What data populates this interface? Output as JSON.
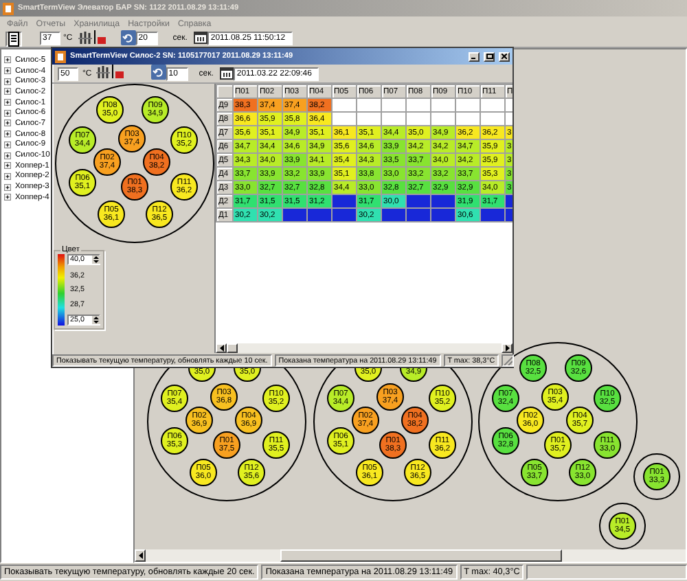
{
  "window": {
    "title": "SmartTermView Элеватор БАР SN: 1122 2011.08.29 13:11:49",
    "active": false
  },
  "menu": [
    "Файл",
    "Отчеты",
    "Хранилища",
    "Настройки",
    "Справка"
  ],
  "toolbar": {
    "temperature": "37",
    "temperature_unit": "°C",
    "interval": "20",
    "interval_unit": "сек.",
    "datetime": "2011.08.25 11:50:12"
  },
  "tree": [
    {
      "label": "Силос-5",
      "expanded": false
    },
    {
      "label": "Силос-4",
      "expanded": false
    },
    {
      "label": "Силос-3",
      "expanded": false
    },
    {
      "label": "Силос-2",
      "expanded": false
    },
    {
      "label": "Силос-1",
      "expanded": false
    },
    {
      "label": "Силос-6",
      "expanded": false
    },
    {
      "label": "Силос-7",
      "expanded": false
    },
    {
      "label": "Силос-8",
      "expanded": false
    },
    {
      "label": "Силос-9",
      "expanded": false
    },
    {
      "label": "Силос-10",
      "expanded": false
    },
    {
      "label": "Хоппер-1",
      "expanded": false
    },
    {
      "label": "Хоппер-2",
      "expanded": false
    },
    {
      "label": "Хоппер-3",
      "expanded": false
    },
    {
      "label": "Хоппер-4",
      "expanded": false
    }
  ],
  "silos": [
    {
      "kind": "silo",
      "sensors": [
        {
          "value": "35,0",
          "color": "#e0f020"
        },
        {
          "value": "35,0",
          "color": "#e0f020"
        },
        {
          "label": "П07",
          "value": "35,4",
          "color": "#e0f020"
        },
        {
          "label": "П03",
          "value": "36,8",
          "color": "#f8c020"
        },
        {
          "label": "П10",
          "value": "35,2",
          "color": "#e0f020"
        },
        {
          "label": "П02",
          "value": "36,9",
          "color": "#f8c020"
        },
        {
          "label": "П04",
          "value": "36,9",
          "color": "#f8c020"
        },
        {
          "label": "П06",
          "value": "35,3",
          "color": "#e0f020"
        },
        {
          "label": "П01",
          "value": "37,5",
          "color": "#f8a020"
        },
        {
          "label": "П11",
          "value": "35,5",
          "color": "#e0f020"
        },
        {
          "label": "П05",
          "value": "36,0",
          "color": "#f8e820"
        },
        {
          "label": "П12",
          "value": "35,6",
          "color": "#e0f020"
        }
      ]
    },
    {
      "kind": "silo",
      "sensors": [
        {
          "value": "35,0",
          "color": "#e0f020"
        },
        {
          "value": "34,9",
          "color": "#b8ec28"
        },
        {
          "label": "П07",
          "value": "34,4",
          "color": "#b8ec28"
        },
        {
          "label": "П03",
          "value": "37,4",
          "color": "#f8a020"
        },
        {
          "label": "П10",
          "value": "35,2",
          "color": "#e0f020"
        },
        {
          "label": "П02",
          "value": "37,4",
          "color": "#f8a020"
        },
        {
          "label": "П04",
          "value": "38,2",
          "color": "#f07020"
        },
        {
          "label": "П06",
          "value": "35,1",
          "color": "#e0f020"
        },
        {
          "label": "П01",
          "value": "38,3",
          "color": "#f07020"
        },
        {
          "label": "П11",
          "value": "36,2",
          "color": "#f8e820"
        },
        {
          "label": "П05",
          "value": "36,1",
          "color": "#f8e820"
        },
        {
          "label": "П12",
          "value": "36,5",
          "color": "#f8e820"
        }
      ]
    },
    {
      "kind": "silo",
      "sensors": [
        {
          "label": "П08",
          "value": "32,5",
          "color": "#58e040"
        },
        {
          "label": "П09",
          "value": "32,6",
          "color": "#58e040"
        },
        {
          "label": "П07",
          "value": "32,4",
          "color": "#58e040"
        },
        {
          "label": "П03",
          "value": "35,4",
          "color": "#e0f020"
        },
        {
          "label": "П10",
          "value": "32,5",
          "color": "#58e040"
        },
        {
          "label": "П02",
          "value": "36,0",
          "color": "#f8e820"
        },
        {
          "label": "П04",
          "value": "35,7",
          "color": "#e0f020"
        },
        {
          "label": "П06",
          "value": "32,8",
          "color": "#58e040"
        },
        {
          "label": "П01",
          "value": "35,7",
          "color": "#e0f020"
        },
        {
          "label": "П11",
          "value": "33,0",
          "color": "#88e430"
        },
        {
          "label": "П05",
          "value": "33,7",
          "color": "#88e430"
        },
        {
          "label": "П12",
          "value": "33,0",
          "color": "#88e430"
        }
      ]
    },
    {
      "kind": "hopper",
      "sensors": [
        {
          "label": "П01",
          "value": "33,3",
          "color": "#88e430"
        }
      ]
    },
    {
      "kind": "hopper",
      "sensors": [
        {
          "label": "П01",
          "value": "34,5",
          "color": "#b8ec28"
        }
      ]
    }
  ],
  "child_window": {
    "title": "SmartTermView Силос-2 SN: 1105177017 2011.08.29 13:11:49",
    "active": true,
    "toolbar": {
      "temperature": "50",
      "temperature_unit": "°C",
      "interval": "10",
      "interval_unit": "сек.",
      "datetime": "2011.03.22 22:09:46"
    },
    "silo": {
      "kind": "silo",
      "sensors": [
        {
          "label": "П08",
          "value": "35,0",
          "color": "#e0f020"
        },
        {
          "label": "П09",
          "value": "34,9",
          "color": "#b8ec28"
        },
        {
          "label": "П07",
          "value": "34,4",
          "color": "#b8ec28"
        },
        {
          "label": "П03",
          "value": "37,4",
          "color": "#f8a020"
        },
        {
          "label": "П10",
          "value": "35,2",
          "color": "#e0f020"
        },
        {
          "label": "П02",
          "value": "37,4",
          "color": "#f8a020"
        },
        {
          "label": "П04",
          "value": "38,2",
          "color": "#f07020"
        },
        {
          "label": "П06",
          "value": "35,1",
          "color": "#e0f020"
        },
        {
          "label": "П01",
          "value": "38,3",
          "color": "#f07020"
        },
        {
          "label": "П11",
          "value": "36,2",
          "color": "#f8e820"
        },
        {
          "label": "П05",
          "value": "36,1",
          "color": "#f8e820"
        },
        {
          "label": "П12",
          "value": "36,5",
          "color": "#f8e820"
        }
      ]
    },
    "legend": {
      "title": "Цвет",
      "max": "40,0",
      "ticks": [
        "36,2",
        "32,5",
        "28,7"
      ],
      "min": "25,0"
    },
    "table": {
      "columns": [
        "П01",
        "П02",
        "П03",
        "П04",
        "П05",
        "П06",
        "П07",
        "П08",
        "П09",
        "П10",
        "П11",
        "П"
      ],
      "rows": [
        {
          "label": "Д9",
          "cells": [
            {
              "value": "38,3",
              "color": "#f07020"
            },
            {
              "value": "37,4",
              "color": "#f8a020"
            },
            {
              "value": "37,4",
              "color": "#f8a020"
            },
            {
              "value": "38,2",
              "color": "#f07020"
            },
            null,
            null,
            null,
            null,
            null,
            null,
            null,
            null
          ]
        },
        {
          "label": "Д8",
          "cells": [
            {
              "value": "36,6",
              "color": "#f8e820"
            },
            {
              "value": "35,9",
              "color": "#e0f020"
            },
            {
              "value": "35,8",
              "color": "#e0f020"
            },
            {
              "value": "36,4",
              "color": "#f8e820"
            },
            null,
            null,
            null,
            null,
            null,
            null,
            null,
            null
          ]
        },
        {
          "label": "Д7",
          "cells": [
            {
              "value": "35,6",
              "color": "#e0f020"
            },
            {
              "value": "35,1",
              "color": "#e0f020"
            },
            {
              "value": "34,9",
              "color": "#b8ec28"
            },
            {
              "value": "35,1",
              "color": "#e0f020"
            },
            {
              "value": "36,1",
              "color": "#f8e820"
            },
            {
              "value": "35,1",
              "color": "#e0f020"
            },
            {
              "value": "34,4",
              "color": "#b8ec28"
            },
            {
              "value": "35,0",
              "color": "#e0f020"
            },
            {
              "value": "34,9",
              "color": "#b8ec28"
            },
            {
              "value": "36,2",
              "color": "#f8e820"
            },
            {
              "value": "36,2",
              "color": "#f8e820"
            },
            {
              "value": "3",
              "color": "#f8e820"
            }
          ]
        },
        {
          "label": "Д6",
          "cells": [
            {
              "value": "34,7",
              "color": "#b8ec28"
            },
            {
              "value": "34,4",
              "color": "#b8ec28"
            },
            {
              "value": "34,6",
              "color": "#b8ec28"
            },
            {
              "value": "34,9",
              "color": "#b8ec28"
            },
            {
              "value": "35,6",
              "color": "#e0f020"
            },
            {
              "value": "34,6",
              "color": "#b8ec28"
            },
            {
              "value": "33,9",
              "color": "#88e430"
            },
            {
              "value": "34,2",
              "color": "#b8ec28"
            },
            {
              "value": "34,2",
              "color": "#b8ec28"
            },
            {
              "value": "34,7",
              "color": "#b8ec28"
            },
            {
              "value": "35,9",
              "color": "#e0f020"
            },
            {
              "value": "3",
              "color": "#b8ec28"
            }
          ]
        },
        {
          "label": "Д5",
          "cells": [
            {
              "value": "34,3",
              "color": "#b8ec28"
            },
            {
              "value": "34,0",
              "color": "#b8ec28"
            },
            {
              "value": "33,9",
              "color": "#88e430"
            },
            {
              "value": "34,1",
              "color": "#b8ec28"
            },
            {
              "value": "35,4",
              "color": "#e0f020"
            },
            {
              "value": "34,3",
              "color": "#b8ec28"
            },
            {
              "value": "33,5",
              "color": "#88e430"
            },
            {
              "value": "33,7",
              "color": "#88e430"
            },
            {
              "value": "34,0",
              "color": "#b8ec28"
            },
            {
              "value": "34,2",
              "color": "#b8ec28"
            },
            {
              "value": "35,9",
              "color": "#e0f020"
            },
            {
              "value": "3",
              "color": "#b8ec28"
            }
          ]
        },
        {
          "label": "Д4",
          "cells": [
            {
              "value": "33,7",
              "color": "#88e430"
            },
            {
              "value": "33,9",
              "color": "#88e430"
            },
            {
              "value": "33,2",
              "color": "#88e430"
            },
            {
              "value": "33,9",
              "color": "#88e430"
            },
            {
              "value": "35,1",
              "color": "#e0f020"
            },
            {
              "value": "33,8",
              "color": "#88e430"
            },
            {
              "value": "33,0",
              "color": "#88e430"
            },
            {
              "value": "33,2",
              "color": "#88e430"
            },
            {
              "value": "33,2",
              "color": "#88e430"
            },
            {
              "value": "33,7",
              "color": "#88e430"
            },
            {
              "value": "35,3",
              "color": "#e0f020"
            },
            {
              "value": "3",
              "color": "#88e430"
            }
          ]
        },
        {
          "label": "Д3",
          "cells": [
            {
              "value": "33,0",
              "color": "#88e430"
            },
            {
              "value": "32,7",
              "color": "#58e040"
            },
            {
              "value": "32,7",
              "color": "#58e040"
            },
            {
              "value": "32,8",
              "color": "#58e040"
            },
            {
              "value": "34,4",
              "color": "#b8ec28"
            },
            {
              "value": "33,0",
              "color": "#88e430"
            },
            {
              "value": "32,8",
              "color": "#58e040"
            },
            {
              "value": "32,7",
              "color": "#58e040"
            },
            {
              "value": "32,9",
              "color": "#58e040"
            },
            {
              "value": "32,9",
              "color": "#58e040"
            },
            {
              "value": "34,0",
              "color": "#b8ec28"
            },
            {
              "value": "3",
              "color": "#58e040"
            }
          ]
        },
        {
          "label": "Д2",
          "cells": [
            {
              "value": "31,7",
              "color": "#30e070"
            },
            {
              "value": "31,5",
              "color": "#30e070"
            },
            {
              "value": "31,5",
              "color": "#30e070"
            },
            {
              "value": "31,2",
              "color": "#30e070"
            },
            {
              "color": "#1828d8"
            },
            {
              "value": "31,7",
              "color": "#30e070"
            },
            {
              "value": "30,0",
              "color": "#30e0b0"
            },
            {
              "color": "#1828d8"
            },
            {
              "color": "#1828d8"
            },
            {
              "value": "31,9",
              "color": "#30e070"
            },
            {
              "value": "31,7",
              "color": "#30e070"
            },
            {
              "color": "#1828d8"
            }
          ]
        },
        {
          "label": "Д1",
          "cells": [
            {
              "value": "30,2",
              "color": "#30e0b0"
            },
            {
              "value": "30,2",
              "color": "#30e0b0"
            },
            {
              "color": "#1828d8"
            },
            {
              "color": "#1828d8"
            },
            {
              "color": "#1828d8"
            },
            {
              "value": "30,2",
              "color": "#30e0b0"
            },
            {
              "color": "#1828d8"
            },
            {
              "color": "#1828d8"
            },
            {
              "color": "#1828d8"
            },
            {
              "value": "30,6",
              "color": "#30e0b0"
            },
            {
              "color": "#1828d8"
            },
            {
              "color": "#1828d8"
            }
          ]
        }
      ]
    },
    "status_bar": [
      "Показывать текущую температуру, обновлять каждые 10 сек.",
      "Показана температура на 2011.08.29 13:11:49",
      "T max: 38,3°C"
    ]
  },
  "status_bar": [
    "Показывать текущую температуру, обновлять каждые 20 сек.",
    "Показана температура на 2011.08.29 13:11:49",
    "T max: 40,3°C"
  ]
}
